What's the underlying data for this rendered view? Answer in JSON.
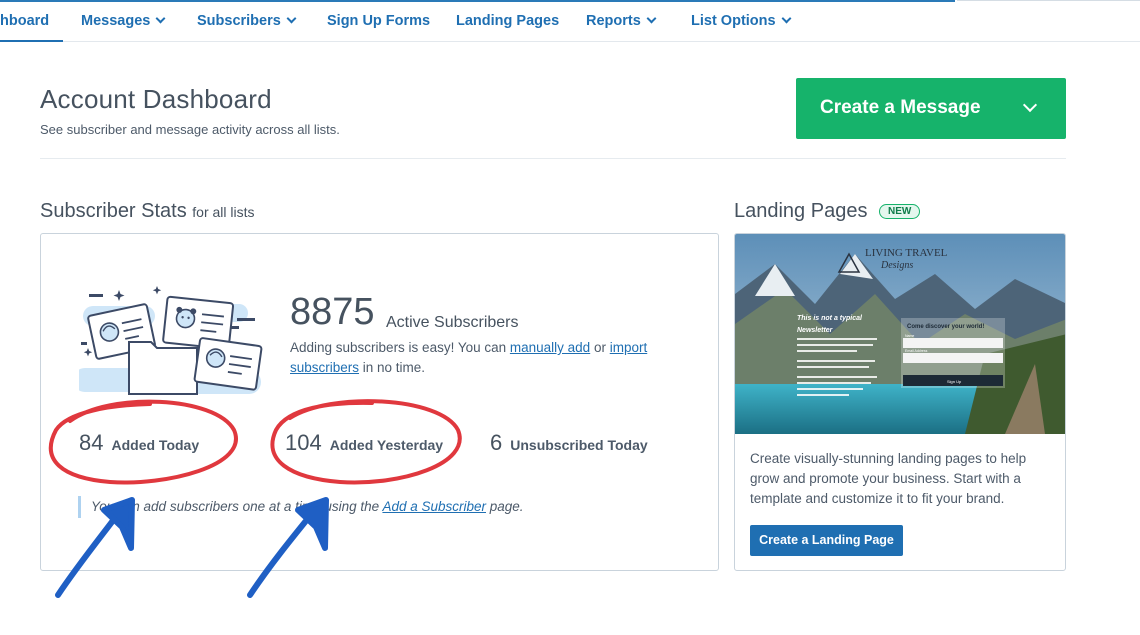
{
  "nav": {
    "items": [
      {
        "label": "hboard",
        "active": true
      },
      {
        "label": "Messages",
        "dropdown": true
      },
      {
        "label": "Subscribers",
        "dropdown": true
      },
      {
        "label": "Sign Up Forms",
        "dropdown": false
      },
      {
        "label": "Landing Pages",
        "dropdown": false
      },
      {
        "label": "Reports",
        "dropdown": true
      },
      {
        "label": "List Options",
        "dropdown": true
      }
    ]
  },
  "header": {
    "title": "Account Dashboard",
    "subtitle": "See subscriber and message activity across all lists.",
    "create_button": "Create a Message"
  },
  "subscriber_stats": {
    "title": "Subscriber Stats",
    "title_suffix": "for all lists",
    "active_count": "8875",
    "active_label": "Active Subscribers",
    "desc_prefix": "Adding subscribers is easy! You can ",
    "link_manual": "manually add",
    "desc_mid": " or ",
    "link_import": "import subscribers",
    "desc_suffix": " in no time.",
    "stats": [
      {
        "value": "84",
        "label": "Added Today"
      },
      {
        "value": "104",
        "label": "Added Yesterday"
      },
      {
        "value": "6",
        "label": "Unsubscribed Today"
      }
    ],
    "note_prefix": "You can add subscribers one at a time using the ",
    "note_link": "Add a Subscriber",
    "note_suffix": " page."
  },
  "landing_pages": {
    "title": "Landing Pages",
    "badge": "NEW",
    "preview": {
      "brand_line1": "LIVING TRAVEL",
      "brand_line2": "Designs",
      "headline1": "This is not a typical",
      "headline2": "Newsletter",
      "form_title": "Come discover your world!",
      "form_name": "Name",
      "form_email": "Email Address",
      "form_button": "Sign Up"
    },
    "description": "Create visually-stunning landing pages to help grow and promote your business. Start with a template and customize it to fit your brand.",
    "button": "Create a Landing Page"
  },
  "colors": {
    "brand_blue": "#1f6fb2",
    "create_green": "#16b36b",
    "annotation_red": "#e0383e",
    "annotation_blue": "#1f5fc4"
  }
}
